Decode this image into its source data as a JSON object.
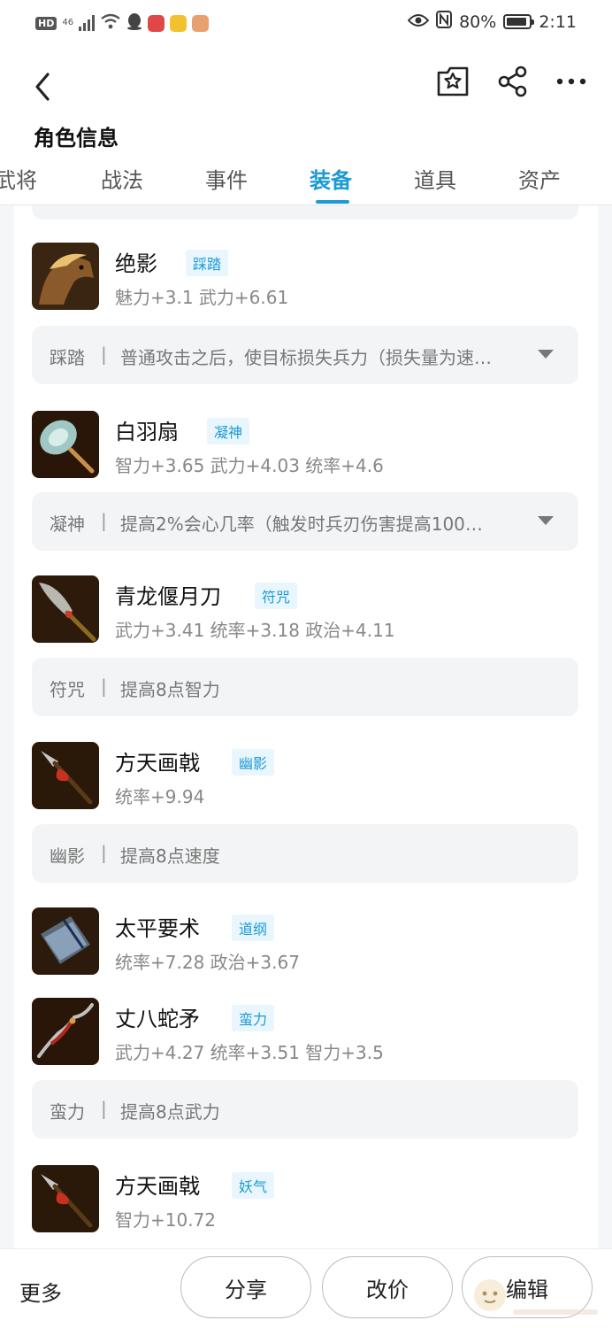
{
  "status_bar": {
    "hd": "HD",
    "network": "46",
    "battery_percent": "80%",
    "time": "2:11",
    "icons": [
      "signal-icon",
      "wifi-icon",
      "qq-penguin-icon",
      "app-red-icon",
      "app-yellow-icon",
      "message-icon",
      "eye-icon",
      "nfc-icon",
      "battery-icon"
    ]
  },
  "header": {
    "title": "角色信息",
    "icons": [
      "back-arrow-icon",
      "favorite-star-icon",
      "share-icon",
      "more-dots-icon"
    ]
  },
  "tabs": [
    {
      "label": "武将"
    },
    {
      "label": "战法"
    },
    {
      "label": "事件"
    },
    {
      "label": "装备",
      "active": true
    },
    {
      "label": "道具"
    },
    {
      "label": "资产"
    }
  ],
  "equipment": [
    {
      "name": "绝影",
      "tag": "踩踏",
      "stats": "魅力+3.1 武力+6.61",
      "icon": "horse-icon",
      "skill": {
        "name": "踩踏",
        "desc": "普通攻击之后，使目标损失兵力（损失量为速…",
        "expandable": true
      }
    },
    {
      "name": "白羽扇",
      "tag": "凝神",
      "stats": "智力+3.65 武力+4.03 统率+4.6",
      "icon": "feather-fan-icon",
      "skill": {
        "name": "凝神",
        "desc": "提高2%会心几率（触发时兵刃伤害提高100…",
        "expandable": true
      }
    },
    {
      "name": "青龙偃月刀",
      "tag": "符咒",
      "stats": "武力+3.41 统率+3.18 政治+4.11",
      "icon": "glaive-icon",
      "skill": {
        "name": "符咒",
        "desc": "提高8点智力",
        "expandable": false
      }
    },
    {
      "name": "方天画戟",
      "tag": "幽影",
      "stats": "统率+9.94",
      "icon": "halberd-icon",
      "skill": {
        "name": "幽影",
        "desc": "提高8点速度",
        "expandable": false
      }
    },
    {
      "name": "太平要术",
      "tag": "道纲",
      "stats": "统率+7.28 政治+3.67",
      "icon": "book-icon",
      "skill": null
    },
    {
      "name": "丈八蛇矛",
      "tag": "蛮力",
      "stats": "武力+4.27 统率+3.51 智力+3.5",
      "icon": "snake-spear-icon",
      "skill": {
        "name": "蛮力",
        "desc": "提高8点武力",
        "expandable": false
      }
    },
    {
      "name": "方天画戟",
      "tag": "妖气",
      "stats": "智力+10.72",
      "icon": "halberd-icon",
      "skill": null
    }
  ],
  "bottom_bar": {
    "more": "更多",
    "share": "分享",
    "change_price": "改价",
    "edit": "编辑"
  },
  "colors": {
    "accent": "#1a9ad6",
    "tag_bg": "#eaf6fd",
    "skill_bg": "#f3f4f6"
  }
}
